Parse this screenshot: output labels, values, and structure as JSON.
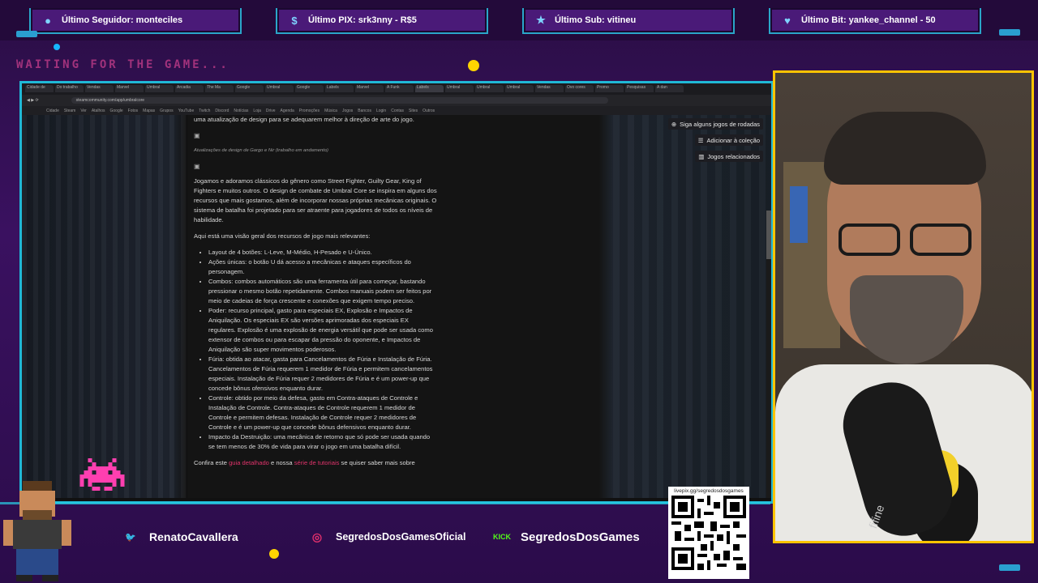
{
  "alerts": [
    {
      "icon": "person-icon",
      "label": "Último Seguidor: monteciles"
    },
    {
      "icon": "pix-icon",
      "label": "Último PIX: srk3nny - R$5"
    },
    {
      "icon": "star-icon",
      "label": "Último Sub: vitineu"
    },
    {
      "icon": "heart-icon",
      "label": "Último Bit: yankee_channel - 50"
    }
  ],
  "neon_text": "WAITING FOR THE GAME...",
  "browser": {
    "tabs": [
      "Cidade de",
      "Do trabalho",
      "Vendas",
      "Marvel",
      "Umbral",
      "Arcadia",
      "The Ma",
      "Google",
      "Umbral",
      "Google",
      "Labels",
      "Marvel",
      "A Funk",
      "Labels",
      "Umbral",
      "Umbral",
      "Umbral",
      "Vendas",
      "Ovo cores",
      "Promo",
      "Pesquisas",
      "A dan"
    ],
    "url": "steamcommunity.com/app/umbralcore",
    "bookmarks": [
      "Cidade",
      "Steam",
      "Ver",
      "Atalhos",
      "Google",
      "Fotos",
      "Mapas",
      "Grupos",
      "YouTube",
      "Twitch",
      "Discord",
      "Notícias",
      "Loja",
      "Drive",
      "Agenda",
      "Promoções",
      "Música",
      "Jogos",
      "Bancos",
      "Login",
      "Contas",
      "Sites",
      "Outros"
    ]
  },
  "article": {
    "intro": "uma atualização de design para se adequarem melhor à direção de arte do jogo.",
    "caption": "Atualizações de design de Gargo e Nir (trabalho em andamento)",
    "broken_img": "▣",
    "p1": "Jogamos e adoramos clássicos do gênero como Street Fighter, Guilty Gear, King of Fighters e muitos outros. O design de combate de Umbral Core se inspira em alguns dos recursos que mais gostamos, além de incorporar nossas próprias mecânicas originais. O sistema de batalha foi projetado para ser atraente para jogadores de todos os níveis de habilidade.",
    "p2": "Aqui está uma visão geral dos recursos de jogo mais relevantes:",
    "items": [
      "Layout de 4 botões: L-Leve, M-Médio, H-Pesado e U-Único.",
      "Ações únicas: o botão U dá acesso a mecânicas e ataques específicos do personagem.",
      "Combos: combos automáticos são uma ferramenta útil para começar, bastando pressionar o mesmo botão repetidamente. Combos manuais podem ser feitos por meio de cadeias de força crescente e conexões que exigem tempo preciso.",
      "Poder: recurso principal, gasto para especiais EX, Explosão e Impactos de Aniquilação. Os especiais EX são versões aprimoradas dos especiais EX regulares. Explosão é uma explosão de energia versátil que pode ser usada como extensor de combos ou para escapar da pressão do oponente, e Impactos de Aniquilação são super movimentos poderosos.",
      "Fúria: obtida ao atacar, gasta para Cancelamentos de Fúria e Instalação de Fúria. Cancelamentos de Fúria requerem 1 medidor de Fúria e permitem cancelamentos especiais. Instalação de Fúria requer 2 medidores de Fúria e é um power-up que concede bônus ofensivos enquanto durar.",
      "Controle: obtido por meio da defesa, gasto em Contra-ataques de Controle e Instalação de Controle. Contra-ataques de Controle requerem 1 medidor de Controle e permitem defesas. Instalação de Controle requer 2 medidores de Controle e é um power-up que concede bônus defensivos enquanto durar.",
      "Impacto da Destruição: uma mecânica de retorno que só pode ser usada quando se tem menos de 30% de vida para virar o jogo em uma batalha difícil."
    ],
    "outro_start": "Confira este ",
    "link1": "guia detalhado",
    "outro_mid": " e nossa ",
    "link2": "série de tutoriais",
    "outro_end": " se quiser saber mais sobre"
  },
  "side_buttons": [
    {
      "icon": "person-plus-icon",
      "label": "Siga alguns jogos de rodadas"
    },
    {
      "icon": "list-plus-icon",
      "label": "Adicionar à coleção"
    },
    {
      "icon": "map-icon",
      "label": "Jogos relacionados"
    }
  ],
  "socials": [
    {
      "icon": "twitter-icon",
      "glyph": "🐦",
      "label": "RenatoCavallera",
      "color": "#1da1f2"
    },
    {
      "icon": "instagram-icon",
      "glyph": "◎",
      "label": "SegredosDosGamesOficial",
      "color": "#e1306c"
    },
    {
      "icon": "kick-icon",
      "glyph": "KICK",
      "label": "SegredosDosGames",
      "color": "#53fc18"
    }
  ],
  "qr": {
    "url": "livepix.gg/segredosdosgames"
  },
  "mic_brand": "fifine"
}
